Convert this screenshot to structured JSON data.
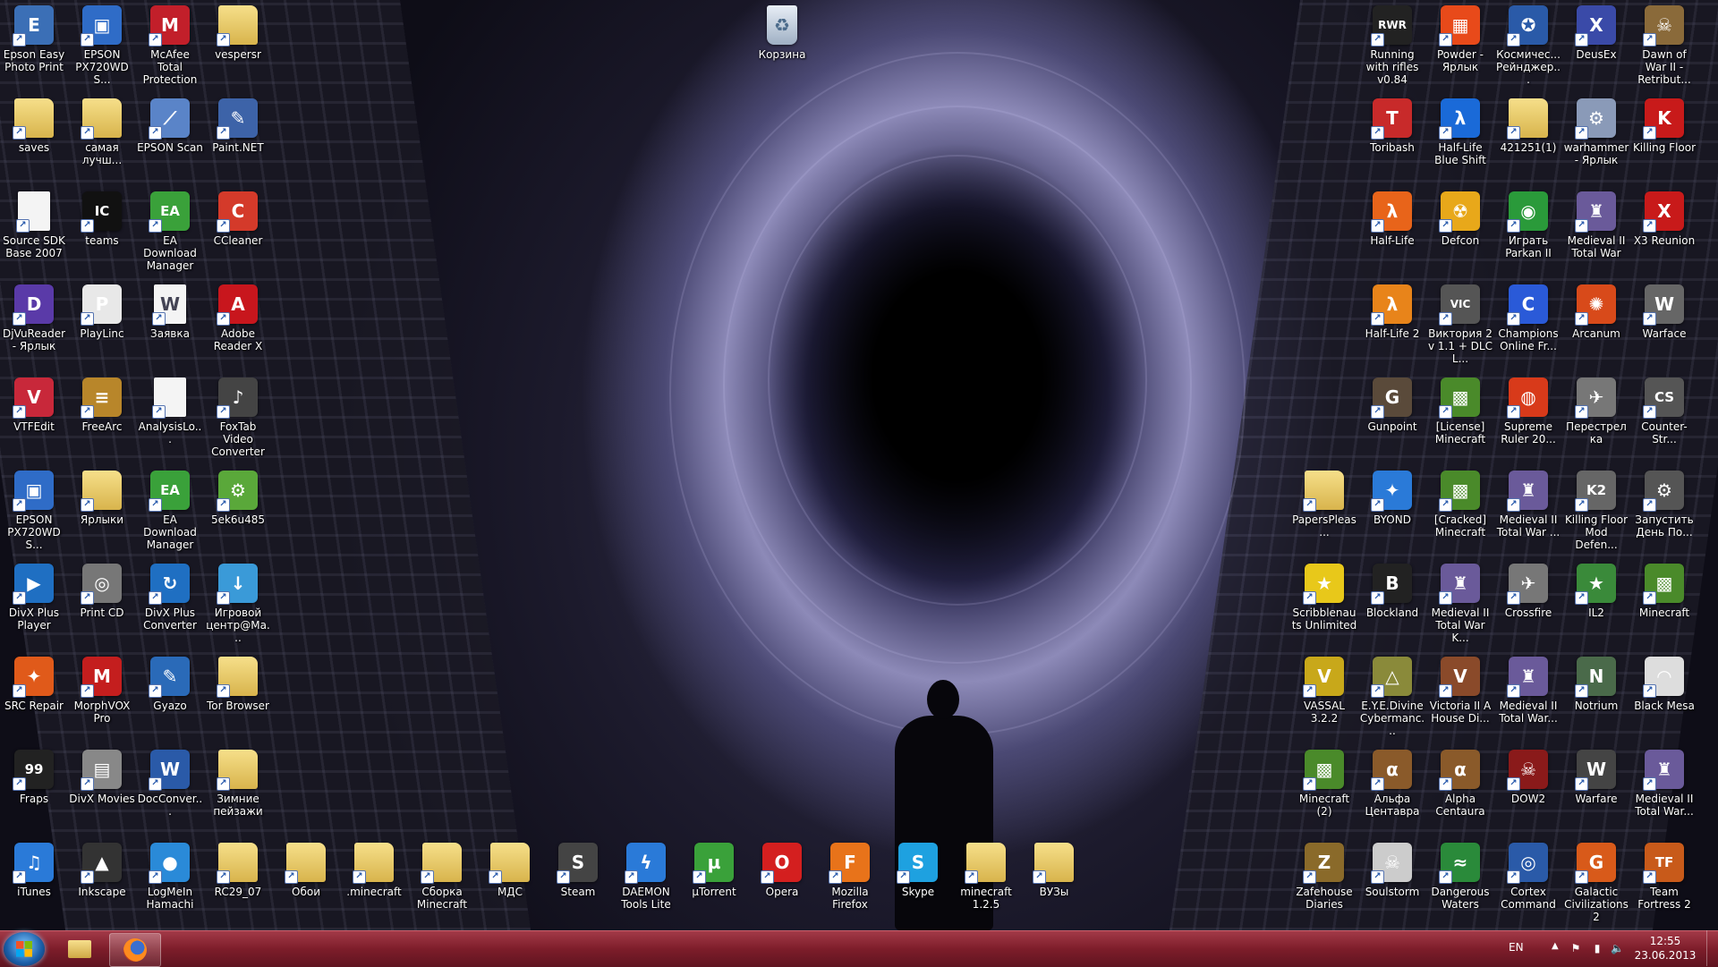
{
  "desktop": {
    "recycle_bin": {
      "label": "Корзина",
      "icon": "recycle-bin-icon"
    },
    "icons": [
      {
        "label": "Epson Easy Photo Print",
        "icon": "printer-icon",
        "color": "#3b6fb6",
        "glyph": "E"
      },
      {
        "label": "EPSON PX720WD S...",
        "icon": "monitor-icon",
        "color": "#2f6cc7",
        "glyph": "▣"
      },
      {
        "label": "McAfee Total Protection",
        "icon": "mcafee-shield-icon",
        "color": "#c21f2a",
        "glyph": "M"
      },
      {
        "label": "vespersr",
        "icon": "folder-icon",
        "folder": true
      },
      {
        "label": "saves",
        "icon": "folder-icon",
        "folder": true
      },
      {
        "label": "самая лучш...",
        "icon": "folder-icon",
        "folder": true
      },
      {
        "label": "EPSON Scan",
        "icon": "scanner-icon",
        "color": "#5a84c8",
        "glyph": "⟋"
      },
      {
        "label": "Paint.NET",
        "icon": "paint-icon",
        "color": "#3d63a8",
        "glyph": "✎"
      },
      {
        "label": "Source SDK Base 2007",
        "icon": "document-icon",
        "doc": true,
        "glyph": ""
      },
      {
        "label": "teams",
        "icon": "infocom-icon",
        "color": "#111111",
        "glyph": "IC"
      },
      {
        "label": "EA Download Manager",
        "icon": "ea-icon",
        "color": "#3aa13a",
        "glyph": "EA"
      },
      {
        "label": "CCleaner",
        "icon": "ccleaner-icon",
        "color": "#d43a2a",
        "glyph": "C"
      },
      {
        "label": "DjVuReader - Ярлык",
        "icon": "djvu-icon",
        "color": "#5a3aa8",
        "glyph": "D"
      },
      {
        "label": "PlayLinc",
        "icon": "playlinc-icon",
        "color": "#e8e8e8",
        "glyph": "P"
      },
      {
        "label": "Заявка",
        "icon": "word-document-icon",
        "doc": true,
        "glyph": "W"
      },
      {
        "label": "Adobe Reader X",
        "icon": "adobe-reader-icon",
        "color": "#c8161d",
        "glyph": "A"
      },
      {
        "label": "VTFEdit",
        "icon": "vtfedit-icon",
        "color": "#c8283a",
        "glyph": "V"
      },
      {
        "label": "FreeArc",
        "icon": "archive-icon",
        "color": "#b8862a",
        "glyph": "≡"
      },
      {
        "label": "AnalysisLo...",
        "icon": "document-icon",
        "doc": true,
        "glyph": ""
      },
      {
        "label": "FoxTab Video Converter",
        "icon": "speaker-icon",
        "color": "#444444",
        "glyph": "♪"
      },
      {
        "label": "EPSON PX720WD S...",
        "icon": "monitor-icon",
        "color": "#2f6cc7",
        "glyph": "▣"
      },
      {
        "label": "Ярлыки",
        "icon": "folder-icon",
        "folder": true
      },
      {
        "label": "EA Download Manager",
        "icon": "ea-icon",
        "color": "#3aa13a",
        "glyph": "EA"
      },
      {
        "label": "5ek6u485",
        "icon": "gear-icon",
        "color": "#5aa83a",
        "glyph": "⚙"
      },
      {
        "label": "DivX Plus Player",
        "icon": "play-icon",
        "color": "#1f6fc2",
        "glyph": "▶"
      },
      {
        "label": "Print CD",
        "icon": "print-cd-icon",
        "color": "#777777",
        "glyph": "◎"
      },
      {
        "label": "DivX Plus Converter",
        "icon": "converter-icon",
        "color": "#1f6fc2",
        "glyph": "↻"
      },
      {
        "label": "Игровой центр@Ма...",
        "icon": "download-icon",
        "color": "#3a9ad8",
        "glyph": "↓"
      },
      {
        "label": "SRC Repair",
        "icon": "src-repair-icon",
        "color": "#e05a1a",
        "glyph": "✦"
      },
      {
        "label": "MorphVOX Pro",
        "icon": "morphvox-icon",
        "color": "#c41e1e",
        "glyph": "M"
      },
      {
        "label": "Gyazo",
        "icon": "gyazo-icon",
        "color": "#2a6ab8",
        "glyph": "✎"
      },
      {
        "label": "Tor Browser",
        "icon": "folder-icon",
        "folder": true
      },
      {
        "label": "Fraps",
        "icon": "fraps-icon",
        "color": "#222222",
        "glyph": "99"
      },
      {
        "label": "DivX Movies",
        "icon": "divx-movies-icon",
        "color": "#888888",
        "glyph": "▤"
      },
      {
        "label": "DocConver...",
        "icon": "word-document-icon",
        "color": "#2a5aa8",
        "glyph": "W"
      },
      {
        "label": "Зимние пейзажи",
        "icon": "folder-icon",
        "folder": true
      },
      {
        "label": "iTunes",
        "icon": "itunes-icon",
        "color": "#2a7ad8",
        "glyph": "♫"
      },
      {
        "label": "Inkscape",
        "icon": "inkscape-icon",
        "color": "#333333",
        "glyph": "▲"
      },
      {
        "label": "LogMeIn Hamachi",
        "icon": "hamachi-icon",
        "color": "#2a8ad8",
        "glyph": "●"
      },
      {
        "label": "RC29_07",
        "icon": "folder-icon",
        "folder": true
      },
      {
        "label": "Обои",
        "icon": "folder-icon",
        "folder": true
      },
      {
        "label": ".minecraft",
        "icon": "folder-icon",
        "folder": true
      },
      {
        "label": "Сборка Minecraft",
        "icon": "folder-icon",
        "folder": true
      },
      {
        "label": "МДС",
        "icon": "folder-icon",
        "folder": true
      },
      {
        "label": "Steam",
        "icon": "steam-icon",
        "color": "#444444",
        "glyph": "S"
      },
      {
        "label": "DAEMON Tools Lite",
        "icon": "daemon-tools-icon",
        "color": "#2a7ad8",
        "glyph": "ϟ"
      },
      {
        "label": "µTorrent",
        "icon": "utorrent-icon",
        "color": "#3aa13a",
        "glyph": "µ"
      },
      {
        "label": "Opera",
        "icon": "opera-icon",
        "color": "#d41f1f",
        "glyph": "O"
      },
      {
        "label": "Mozilla Firefox",
        "icon": "firefox-icon",
        "color": "#e8731a",
        "glyph": "F"
      },
      {
        "label": "Skype",
        "icon": "skype-icon",
        "color": "#1ea1e0",
        "glyph": "S"
      },
      {
        "label": "minecraft 1.2.5",
        "icon": "folder-icon",
        "folder": true
      },
      {
        "label": "ВУЗы",
        "icon": "folder-icon",
        "folder": true
      },
      {
        "label": "Running with rifles v0.84",
        "icon": "rwr-icon",
        "color": "#222222",
        "glyph": "RWR"
      },
      {
        "label": "Powder - Ярлык",
        "icon": "powder-icon",
        "color": "#e84a1a",
        "glyph": "▦"
      },
      {
        "label": "Космичес... Рейнджер...",
        "icon": "space-rangers-icon",
        "color": "#2a5aa8",
        "glyph": "✪"
      },
      {
        "label": "DeusEx",
        "icon": "deusex-icon",
        "color": "#3a4aa8",
        "glyph": "X"
      },
      {
        "label": "Dawn of War II - Retribut...",
        "icon": "dawn-of-war-icon",
        "color": "#8a6a3a",
        "glyph": "☠"
      },
      {
        "label": "Toribash",
        "icon": "toribash-icon",
        "color": "#c82a2a",
        "glyph": "T"
      },
      {
        "label": "Half-Life Blue Shift",
        "icon": "half-life-blue-icon",
        "color": "#1a6ad8",
        "glyph": "λ"
      },
      {
        "label": "421251(1)",
        "icon": "folder-icon",
        "folder": true
      },
      {
        "label": "warhammer - Ярлык",
        "icon": "gear-icon",
        "color": "#8a9ab8",
        "glyph": "⚙"
      },
      {
        "label": "Killing Floor",
        "icon": "killing-floor-icon",
        "color": "#c81a1a",
        "glyph": "K"
      },
      {
        "label": "Half-Life",
        "icon": "half-life-icon",
        "color": "#e8641a",
        "glyph": "λ"
      },
      {
        "label": "Defcon",
        "icon": "defcon-icon",
        "color": "#e8a81a",
        "glyph": "☢"
      },
      {
        "label": "Играть Parkan II",
        "icon": "parkan-icon",
        "color": "#2a9a3a",
        "glyph": "◉"
      },
      {
        "label": "Medieval II Total War",
        "icon": "medieval-icon",
        "color": "#6a5a9a",
        "glyph": "♜"
      },
      {
        "label": "X3 Reunion",
        "icon": "x3-icon",
        "color": "#c81a1a",
        "glyph": "X"
      },
      {
        "label": "Half-Life 2",
        "icon": "half-life-2-icon",
        "color": "#e8841a",
        "glyph": "λ"
      },
      {
        "label": "Виктория 2 v 1.1 + DLC L...",
        "icon": "victoria-icon",
        "color": "#555555",
        "glyph": "VIC"
      },
      {
        "label": "Champions Online Fr...",
        "icon": "champions-online-icon",
        "color": "#2a5ad8",
        "glyph": "C"
      },
      {
        "label": "Arcanum",
        "icon": "arcanum-icon",
        "color": "#d84a1a",
        "glyph": "✺"
      },
      {
        "label": "Warface",
        "icon": "warface-icon",
        "color": "#666666",
        "glyph": "W"
      },
      {
        "label": "Gunpoint",
        "icon": "gunpoint-icon",
        "color": "#5a4a3a",
        "glyph": "G"
      },
      {
        "label": "[License] Minecraft",
        "icon": "minecraft-icon",
        "color": "#4a8a2a",
        "glyph": "▩"
      },
      {
        "label": "Supreme Ruler 20...",
        "icon": "globe-icon",
        "color": "#d83a1a",
        "glyph": "◍"
      },
      {
        "label": "Перестрелка",
        "icon": "jet-icon",
        "color": "#777777",
        "glyph": "✈"
      },
      {
        "label": "Counter-Str...",
        "icon": "counter-strike-icon",
        "color": "#555555",
        "glyph": "CS"
      },
      {
        "label": "PapersPleas...",
        "icon": "folder-icon",
        "folder": true
      },
      {
        "label": "BYOND",
        "icon": "byond-icon",
        "color": "#2a7ad8",
        "glyph": "✦"
      },
      {
        "label": "[Cracked] Minecraft",
        "icon": "minecraft-icon",
        "color": "#4a8a2a",
        "glyph": "▩"
      },
      {
        "label": "Medieval II Total War ...",
        "icon": "medieval-icon",
        "color": "#6a5a9a",
        "glyph": "♜"
      },
      {
        "label": "Killing Floor Mod Defen...",
        "icon": "killing-floor-icon",
        "color": "#666666",
        "glyph": "K2"
      },
      {
        "label": "Запустить День По...",
        "icon": "day-of-defeat-icon",
        "color": "#555555",
        "glyph": "⚙"
      },
      {
        "label": "Scribblenauts Unlimited",
        "icon": "scribblenauts-icon",
        "color": "#e8c81a",
        "glyph": "★"
      },
      {
        "label": "Blockland",
        "icon": "blockland-icon",
        "color": "#222222",
        "glyph": "B"
      },
      {
        "label": "Medieval II Total War K...",
        "icon": "medieval-icon",
        "color": "#6a5a9a",
        "glyph": "♜"
      },
      {
        "label": "Crossfire",
        "icon": "crossfire-icon",
        "color": "#777777",
        "glyph": "✈"
      },
      {
        "label": "IL2",
        "icon": "il2-icon",
        "color": "#3a8a3a",
        "glyph": "★"
      },
      {
        "label": "Minecraft",
        "icon": "minecraft-icon",
        "color": "#4a8a2a",
        "glyph": "▩"
      },
      {
        "label": "VASSAL 3.2.2",
        "icon": "vassal-icon",
        "color": "#c8a81a",
        "glyph": "V"
      },
      {
        "label": "E.Y.E.Divine Cybermanc...",
        "icon": "eye-icon",
        "color": "#8a8a3a",
        "glyph": "△"
      },
      {
        "label": "Victoria II A House Di...",
        "icon": "victoria-icon",
        "color": "#8a4a2a",
        "glyph": "V"
      },
      {
        "label": "Medieval II Total War...",
        "icon": "medieval-icon",
        "color": "#6a5a9a",
        "glyph": "♜"
      },
      {
        "label": "Notrium",
        "icon": "notrium-icon",
        "color": "#4a6a4a",
        "glyph": "N"
      },
      {
        "label": "Black Mesa",
        "icon": "black-mesa-icon",
        "color": "#dddddd",
        "glyph": "◠"
      },
      {
        "label": "Minecraft (2)",
        "icon": "minecraft-icon",
        "color": "#4a8a2a",
        "glyph": "▩"
      },
      {
        "label": "Альфа Центавра",
        "icon": "alpha-centauri-icon",
        "color": "#8a5a2a",
        "glyph": "α"
      },
      {
        "label": "Alpha Centaura",
        "icon": "alpha-centauri-icon",
        "color": "#8a5a2a",
        "glyph": "α"
      },
      {
        "label": "DOW2",
        "icon": "dow2-icon",
        "color": "#8a1a1a",
        "glyph": "☠"
      },
      {
        "label": "Warfare",
        "icon": "warfare-icon",
        "color": "#444444",
        "glyph": "W"
      },
      {
        "label": "Medieval II Total War...",
        "icon": "medieval-icon",
        "color": "#6a5a9a",
        "glyph": "♜"
      },
      {
        "label": "Zafehouse Diaries",
        "icon": "zafehouse-icon",
        "color": "#8a6a2a",
        "glyph": "Z"
      },
      {
        "label": "Soulstorm",
        "icon": "soulstorm-icon",
        "color": "#cccccc",
        "glyph": "☠"
      },
      {
        "label": "Dangerous Waters",
        "icon": "dangerous-waters-icon",
        "color": "#2a8a3a",
        "glyph": "≈"
      },
      {
        "label": "Cortex Command",
        "icon": "cortex-command-icon",
        "color": "#2a5aa8",
        "glyph": "◎"
      },
      {
        "label": "Galactic Civilizations 2",
        "icon": "galactic-civ-icon",
        "color": "#d85a1a",
        "glyph": "G"
      },
      {
        "label": "Team Fortress 2",
        "icon": "team-fortress-icon",
        "color": "#c85a1a",
        "glyph": "TF"
      }
    ]
  },
  "taskbar": {
    "start_icon": "windows-logo-icon",
    "pinned": [
      {
        "name": "explorer",
        "icon": "folder-icon"
      },
      {
        "name": "firefox",
        "icon": "firefox-icon"
      }
    ],
    "tray": {
      "language": "EN",
      "clock_time": "12:55",
      "clock_date": "23.06.2013"
    }
  }
}
